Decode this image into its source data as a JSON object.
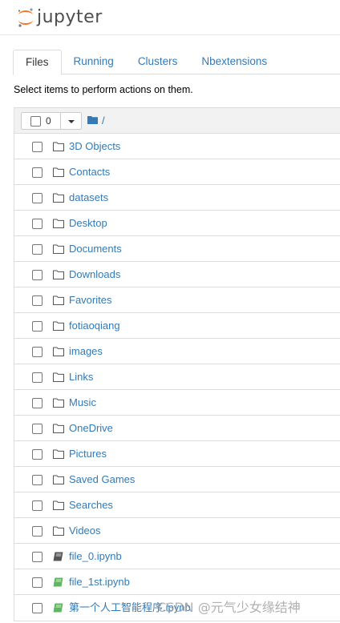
{
  "app": {
    "logo_text": "jupyter"
  },
  "tabs": [
    {
      "label": "Files",
      "active": true
    },
    {
      "label": "Running",
      "active": false
    },
    {
      "label": "Clusters",
      "active": false
    },
    {
      "label": "Nbextensions",
      "active": false
    }
  ],
  "instructions": "Select items to perform actions on them.",
  "toolbar": {
    "selected_count": "0",
    "path": "/"
  },
  "items": [
    {
      "name": "3D Objects",
      "type": "folder"
    },
    {
      "name": "Contacts",
      "type": "folder"
    },
    {
      "name": "datasets",
      "type": "folder"
    },
    {
      "name": "Desktop",
      "type": "folder"
    },
    {
      "name": "Documents",
      "type": "folder"
    },
    {
      "name": "Downloads",
      "type": "folder"
    },
    {
      "name": "Favorites",
      "type": "folder"
    },
    {
      "name": "fotiaoqiang",
      "type": "folder"
    },
    {
      "name": "images",
      "type": "folder"
    },
    {
      "name": "Links",
      "type": "folder"
    },
    {
      "name": "Music",
      "type": "folder"
    },
    {
      "name": "OneDrive",
      "type": "folder"
    },
    {
      "name": "Pictures",
      "type": "folder"
    },
    {
      "name": "Saved Games",
      "type": "folder"
    },
    {
      "name": "Searches",
      "type": "folder"
    },
    {
      "name": "Videos",
      "type": "folder"
    },
    {
      "name": "file_0.ipynb",
      "type": "notebook",
      "running": false
    },
    {
      "name": "file_1st.ipynb",
      "type": "notebook",
      "running": true
    },
    {
      "name": "第一个人工智能程序.ipynb",
      "type": "notebook",
      "running": true
    }
  ],
  "watermark": "CSDN @元气少女缘结神",
  "colors": {
    "link": "#337ab7",
    "notebook_idle": "#555555",
    "notebook_running": "#5cb85c",
    "logo_orange": "#f37726"
  }
}
